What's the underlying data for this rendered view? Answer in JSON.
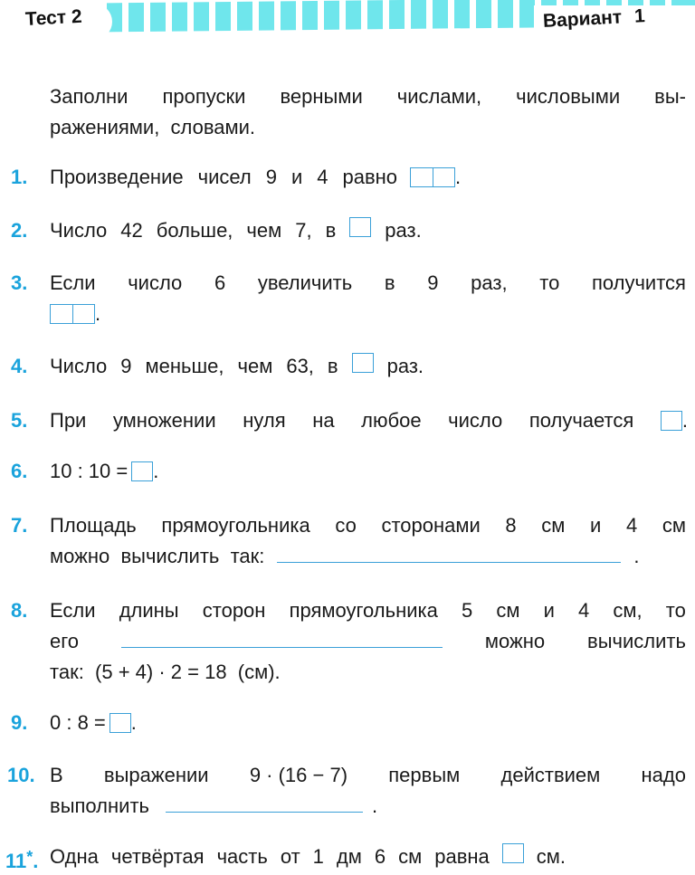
{
  "header": {
    "test_label": "Тест 2",
    "variant_label": "Вариант",
    "variant_number": "1",
    "stripe_color": "#6fe6ec"
  },
  "instructions": {
    "line1": [
      "Заполни",
      "пропуски",
      "верными",
      "числами,",
      "числовыми",
      "вы-"
    ],
    "line2": "ражениями,  словами."
  },
  "accent_color": "#1aa3dc",
  "questions": [
    {
      "num": "1.",
      "lines": [
        [
          "Произведение",
          "чисел",
          "9",
          "и",
          "4",
          "равно"
        ]
      ],
      "answer": "double-box",
      "end": "."
    },
    {
      "num": "2.",
      "lines": [
        [
          "Число",
          "42",
          "больше,",
          "чем",
          "7,",
          "в"
        ]
      ],
      "answer": "box",
      "end": "раз."
    },
    {
      "num": "3.",
      "lines": [
        [
          "Если",
          "число",
          "6",
          "увеличить",
          "в",
          "9",
          "раз,",
          "то",
          "получится"
        ]
      ],
      "answer": "double-box",
      "end": "."
    },
    {
      "num": "4.",
      "lines": [
        [
          "Число",
          "9",
          "меньше,",
          "чем",
          "63,",
          "в"
        ]
      ],
      "answer": "box",
      "end": "раз."
    },
    {
      "num": "5.",
      "lines": [
        [
          "При",
          "умножении",
          "нуля",
          "на",
          "любое",
          "число",
          "получается"
        ]
      ],
      "answer": "box",
      "end": "."
    },
    {
      "num": "6.",
      "text": "10 : 10 =",
      "answer": "box",
      "end": "."
    },
    {
      "num": "7.",
      "line1": [
        "Площадь",
        "прямоугольника",
        "со",
        "сторонами",
        "8",
        "см",
        "и",
        "4",
        "см"
      ],
      "line2": "можно  вычислить  так:",
      "answer": "blank-line",
      "end": "."
    },
    {
      "num": "8.",
      "line1": [
        "Если",
        "длины",
        "сторон",
        "прямоугольника",
        "5",
        "см",
        "и",
        "4",
        "см,",
        "то"
      ],
      "line2_start": "его",
      "line2_end": [
        "можно",
        "вычислить"
      ],
      "line3": "так:  (5 + 4) · 2 = 18  (см).",
      "answer": "blank-line"
    },
    {
      "num": "9.",
      "text": "0 : 8 =",
      "answer": "box",
      "end": "."
    },
    {
      "num": "10.",
      "line1": [
        "В",
        "выражении",
        "9 · (16 − 7)",
        "первым",
        "действием",
        "надо"
      ],
      "line2": "выполнить",
      "answer": "blank-line",
      "end": "."
    },
    {
      "num": "11",
      "star": "*",
      "num_dot": ".",
      "line1": [
        "Одна",
        "четвёртая",
        "часть",
        "от",
        "1",
        "дм",
        "6",
        "см",
        "равна"
      ],
      "answer": "box",
      "end": "см."
    }
  ]
}
